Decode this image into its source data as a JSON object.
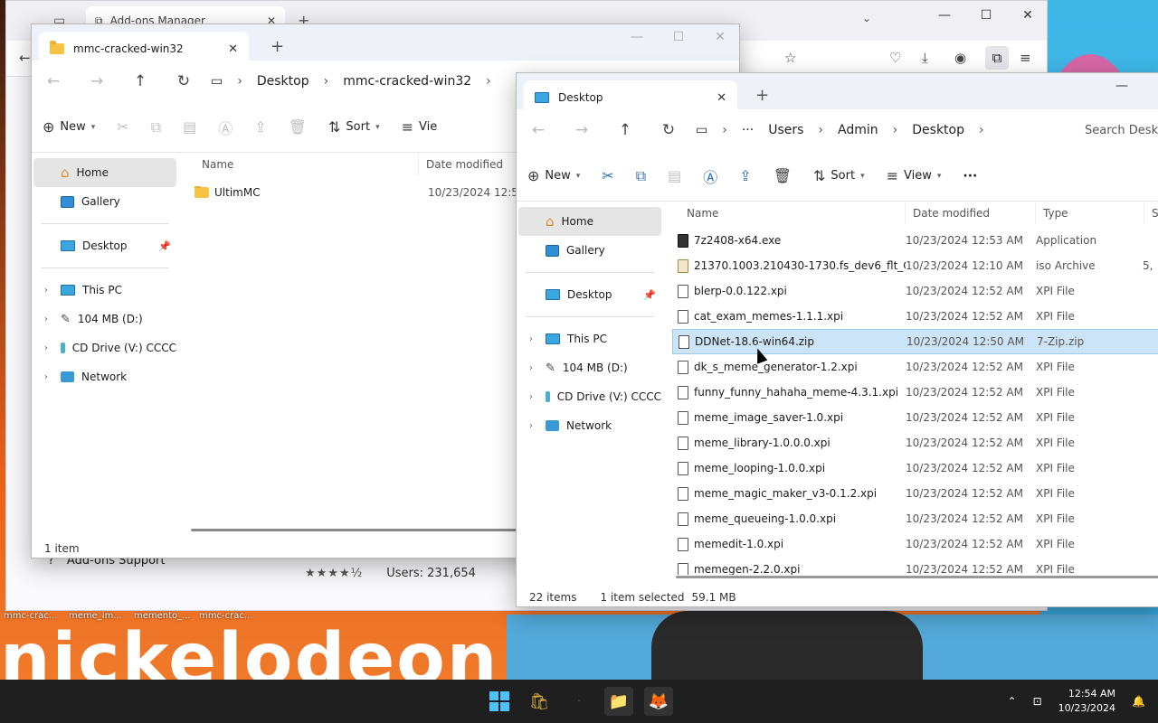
{
  "firefox": {
    "tab_title": "Add-ons Manager",
    "support_link": "Add-ons Support",
    "users": "Users: 231,654",
    "rating_stars": 4.5
  },
  "taskbar_labels": [
    "mmc-crac...",
    "meme_im...",
    "memento_...",
    "mmc-crac..."
  ],
  "left_explorer": {
    "tab_title": "mmc-cracked-win32",
    "breadcrumb": [
      "Desktop",
      "mmc-cracked-win32"
    ],
    "toolbar": {
      "new": "New",
      "sort": "Sort",
      "view": "Vie"
    },
    "nav": [
      {
        "label": "Home"
      },
      {
        "label": "Gallery"
      },
      {
        "label": "Desktop"
      },
      {
        "label": "This PC"
      },
      {
        "label": "104 MB (D:)"
      },
      {
        "label": "CD Drive (V:) CCCC"
      },
      {
        "label": "Network"
      }
    ],
    "columns": {
      "name": "Name",
      "date": "Date modified"
    },
    "files": [
      {
        "name": "UltimMC",
        "date": "10/23/2024 12:54 A"
      }
    ],
    "status": "1 item"
  },
  "right_explorer": {
    "tab_title": "Desktop",
    "breadcrumb": [
      "Users",
      "Admin",
      "Desktop"
    ],
    "search_placeholder": "Search Deskt",
    "toolbar": {
      "new": "New",
      "sort": "Sort",
      "view": "View",
      "more": "···"
    },
    "nav": [
      {
        "label": "Home"
      },
      {
        "label": "Gallery"
      },
      {
        "label": "Desktop"
      },
      {
        "label": "This PC"
      },
      {
        "label": "104 MB (D:)"
      },
      {
        "label": "CD Drive (V:) CCCC"
      },
      {
        "label": "Network"
      }
    ],
    "columns": {
      "name": "Name",
      "date": "Date modified",
      "type": "Type",
      "size": "Si"
    },
    "files": [
      {
        "name": "7z2408-x64.exe",
        "date": "10/23/2024 12:53 AM",
        "type": "Application",
        "size": ""
      },
      {
        "name": "21370.1003.210430-1730.fs_dev6_flt_CLIE...",
        "date": "10/23/2024 12:10 AM",
        "type": "iso Archive",
        "size": "5,"
      },
      {
        "name": "blerp-0.0.122.xpi",
        "date": "10/23/2024 12:52 AM",
        "type": "XPI File",
        "size": ""
      },
      {
        "name": "cat_exam_memes-1.1.1.xpi",
        "date": "10/23/2024 12:52 AM",
        "type": "XPI File",
        "size": ""
      },
      {
        "name": "DDNet-18.6-win64.zip",
        "date": "10/23/2024 12:50 AM",
        "type": "7-Zip.zip",
        "size": ""
      },
      {
        "name": "dk_s_meme_generator-1.2.xpi",
        "date": "10/23/2024 12:52 AM",
        "type": "XPI File",
        "size": ""
      },
      {
        "name": "funny_funny_hahaha_meme-4.3.1.xpi",
        "date": "10/23/2024 12:52 AM",
        "type": "XPI File",
        "size": ""
      },
      {
        "name": "meme_image_saver-1.0.xpi",
        "date": "10/23/2024 12:52 AM",
        "type": "XPI File",
        "size": ""
      },
      {
        "name": "meme_library-1.0.0.0.xpi",
        "date": "10/23/2024 12:52 AM",
        "type": "XPI File",
        "size": ""
      },
      {
        "name": "meme_looping-1.0.0.xpi",
        "date": "10/23/2024 12:52 AM",
        "type": "XPI File",
        "size": ""
      },
      {
        "name": "meme_magic_maker_v3-0.1.2.xpi",
        "date": "10/23/2024 12:52 AM",
        "type": "XPI File",
        "size": ""
      },
      {
        "name": "meme_queueing-1.0.0.xpi",
        "date": "10/23/2024 12:52 AM",
        "type": "XPI File",
        "size": ""
      },
      {
        "name": "memedit-1.0.xpi",
        "date": "10/23/2024 12:52 AM",
        "type": "XPI File",
        "size": ""
      },
      {
        "name": "memegen-2.2.0.xpi",
        "date": "10/23/2024 12:52 AM",
        "type": "XPI File",
        "size": ""
      }
    ],
    "selected_index": 4,
    "status": {
      "count": "22 items",
      "selected": "1 item selected",
      "size": "59.1 MB"
    }
  },
  "wallpaper_text": "nickelodeon",
  "clock": {
    "time": "12:54 AM",
    "date": "10/23/2024"
  }
}
